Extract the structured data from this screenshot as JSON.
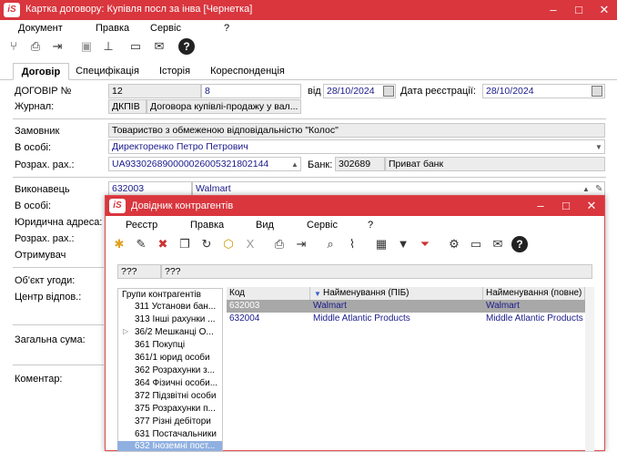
{
  "window": {
    "title": "Картка договору:  Купівля посл за інва [Чернетка]",
    "accent_color": "#d9363e"
  },
  "menu": [
    "Документ",
    "Правка",
    "Сервіс",
    "?"
  ],
  "toolbar_icons": [
    "split-icon",
    "print-icon",
    "exit-icon",
    "save-icon",
    "tree-icon",
    "form-icon",
    "mail-icon",
    "help-icon"
  ],
  "tabs": [
    "Договір",
    "Специфікація",
    "Історія",
    "Кореспонденція"
  ],
  "form": {
    "contract_no_label": "ДОГОВІР №",
    "contract_no_1": "12",
    "contract_no_2": "8",
    "date_from_label": "від",
    "date_from": "28/10/2024",
    "reg_date_label": "Дата реєстрації:",
    "reg_date": "28/10/2024",
    "journal_label": "Журнал:",
    "journal_code": "ДКПІВ",
    "journal_name": "Договора купівлі-продажу у вал...",
    "customer_label": "Замовник",
    "customer_value": "Товариство з обмеженою відповідальністю \"Колос\"",
    "in_person_label": "В особі:",
    "in_person_value": "Директоренко Петро Петрович",
    "account_label": "Розрах. рах.:",
    "account_value": "UA933026890000026005321802144",
    "bank_label": "Банк:",
    "bank_code": "302689",
    "bank_name": "Приват банк",
    "executor_label": "Виконавець",
    "executor_code": "632003",
    "executor_name": "Walmart",
    "in_person2_label": "В особі:",
    "legal_address_label": "Юридична адреса:",
    "account2_label": "Розрах. рах.:",
    "recipient_label": "Отримувач",
    "subject_label": "Об'єкт угоди:",
    "center_label": "Центр відпов.:",
    "total_label": "Загальна сума:",
    "comment_label": "Коментар:"
  },
  "modal": {
    "title": "Довідник контрагентів",
    "menu": [
      "Реєстр",
      "Правка",
      "Вид",
      "Сервіс",
      "?"
    ],
    "toolbar_icons": [
      "new-icon",
      "edit-icon",
      "delete-icon",
      "copy-icon",
      "refresh-icon",
      "package-icon",
      "excel-icon",
      "print-icon",
      "exit-icon",
      "search-icon",
      "attach-icon",
      "grid-icon",
      "filter-icon",
      "filter-clear-icon",
      "settings-icon",
      "form-icon",
      "mail-icon",
      "help-icon"
    ],
    "filter_1": "???",
    "filter_2": "???",
    "groups_header": "Групи контрагентів",
    "groups": [
      "311 Установи бан...",
      "313 Інші рахунки ...",
      "36/2 Мешканці О...",
      "361 Покупці",
      "361/1 юрид особи",
      "362 Розрахунки з...",
      "364 Фізичні особи...",
      "372 Підзвітні особи",
      "375 Розрахунки п...",
      "377 Різні дебітори",
      "631 Постачальники",
      "632 Іноземні пост..."
    ],
    "columns": [
      "Код",
      "Найменування (ПІБ)",
      "Найменування (повне)"
    ],
    "rows": [
      {
        "code": "632003",
        "name": "Walmart",
        "full": "Walmart"
      },
      {
        "code": "632004",
        "name": "Middle Atlantic Products",
        "full": "Middle Atlantic Products"
      }
    ]
  }
}
